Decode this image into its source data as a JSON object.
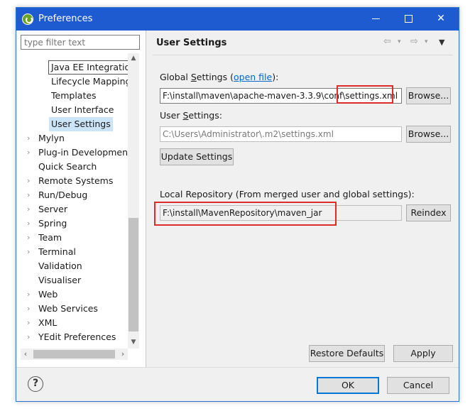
{
  "window": {
    "title": "Preferences"
  },
  "window_controls": {
    "minimize": "—",
    "maximize": "☐",
    "close": "✕"
  },
  "filter": {
    "placeholder": "type filter text"
  },
  "tree": {
    "children": [
      "Java EE Integration",
      "Lifecycle Mapping",
      "Templates",
      "User Interface",
      "User Settings"
    ],
    "items": [
      "Mylyn",
      "Plug-in Development",
      "Quick Search",
      "Remote Systems",
      "Run/Debug",
      "Server",
      "Spring",
      "Team",
      "Terminal",
      "Validation",
      "Visualiser",
      "Web",
      "Web Services",
      "XML",
      "YEdit Preferences"
    ],
    "expand_glyph": "›"
  },
  "page": {
    "title": "User Settings",
    "global_settings_label_pre": "Global ",
    "global_settings_label_s": "S",
    "global_settings_label_post": "ettings (",
    "open_file_link": "open file",
    "global_settings_label_end": "):",
    "global_settings_value": "F:\\install\\maven\\apache-maven-3.3.9\\conf\\settings.xml",
    "user_settings_label_pre": "User ",
    "user_settings_label_s": "S",
    "user_settings_label_post": "ettings:",
    "user_settings_value": "C:\\Users\\Administrator\\.m2\\settings.xml",
    "browse_label": "Browse...",
    "update_settings_label": "Update Settings",
    "local_repo_label": "Local Repository (From merged user and global settings):",
    "local_repo_value": "F:\\install\\MavenRepository\\maven_jar",
    "reindex_label": "Reindex",
    "restore_defaults_label": "Restore Defaults",
    "apply_label": "Apply"
  },
  "footer": {
    "help": "?",
    "ok_label": "OK",
    "cancel_label": "Cancel"
  },
  "colors": {
    "title_bar": "#1e5ad0",
    "highlight_box": "#e02b2b",
    "selection": "#cce4f7"
  }
}
